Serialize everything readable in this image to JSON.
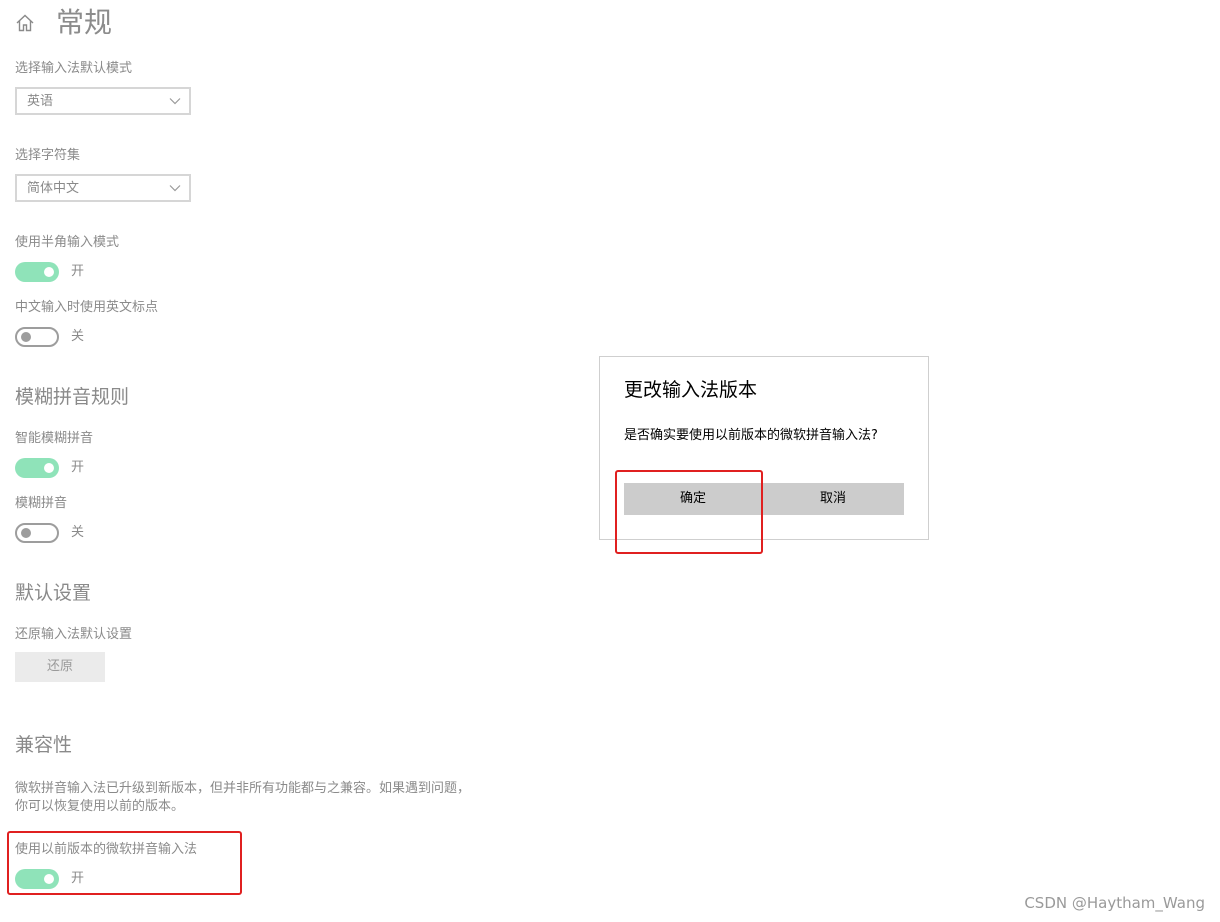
{
  "header": {
    "title": "常规",
    "home_icon": "home-icon"
  },
  "settings": {
    "default_mode_label": "选择输入法默认模式",
    "default_mode_value": "英语",
    "charset_label": "选择字符集",
    "charset_value": "简体中文",
    "half_width_label": "使用半角输入模式",
    "half_width_state": "开",
    "en_punct_label": "中文输入时使用英文标点",
    "en_punct_state": "关"
  },
  "fuzzy": {
    "title": "模糊拼音规则",
    "smart_label": "智能模糊拼音",
    "smart_state": "开",
    "fuzzy_label": "模糊拼音",
    "fuzzy_state": "关"
  },
  "defaults": {
    "title": "默认设置",
    "restore_label": "还原输入法默认设置",
    "restore_button": "还原"
  },
  "compat": {
    "title": "兼容性",
    "description": "微软拼音输入法已升级到新版本，但并非所有功能都与之兼容。如果遇到问题，你可以恢复使用以前的版本。",
    "prev_version_label": "使用以前版本的微软拼音输入法",
    "prev_version_state": "开"
  },
  "dialog": {
    "title": "更改输入法版本",
    "message": "是否确实要使用以前版本的微软拼音输入法?",
    "confirm": "确定",
    "cancel": "取消"
  },
  "watermark": "CSDN @Haytham_Wang",
  "colors": {
    "toggle_on": "#8fe3b9",
    "highlight": "#e02020",
    "dialog_button": "#cccccc"
  }
}
